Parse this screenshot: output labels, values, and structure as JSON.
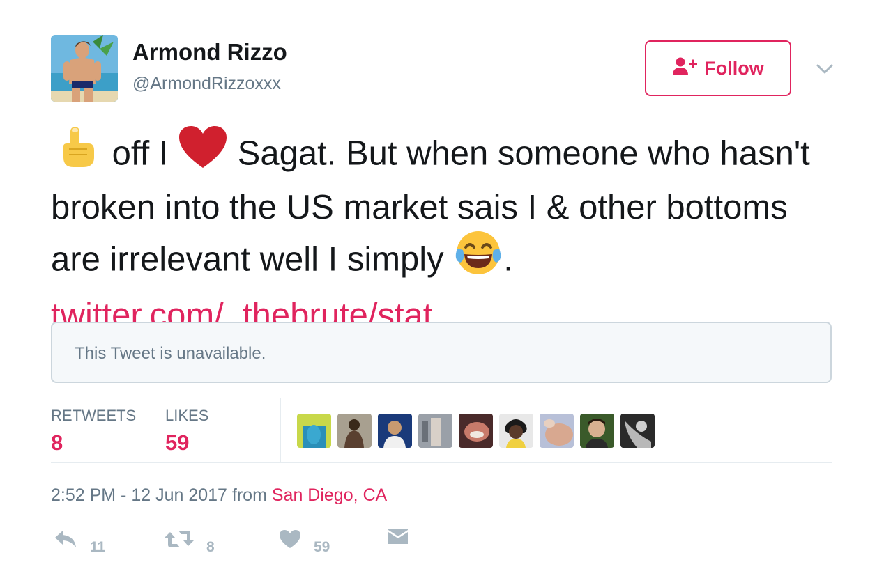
{
  "user": {
    "display_name": "Armond Rizzo",
    "screen_name": "@ArmondRizzoxxx"
  },
  "follow_button": {
    "label": "Follow"
  },
  "tweet": {
    "emoji_1": "☝",
    "segment_1": " off I ",
    "emoji_2": "heart",
    "segment_2": " Sagat. But when someone who hasn't broken into the US market sais I & other bottoms are irrelevant well I simply ",
    "emoji_3": "😂",
    "segment_3": ".",
    "link": "twitter.com/_thebrute/stat …"
  },
  "quoted_tweet": {
    "text": "This Tweet is unavailable."
  },
  "stats": {
    "retweets_label": "RETWEETS",
    "retweets_count": "8",
    "likes_label": "LIKES",
    "likes_count": "59"
  },
  "likers_count_shown": 9,
  "meta": {
    "time_date": "2:52 PM - 12 Jun 2017",
    "from": "from",
    "location": "San Diego, CA"
  },
  "actions": {
    "reply_count": "11",
    "retweet_count": "8",
    "like_count": "59"
  },
  "colors": {
    "accent": "#e0245e",
    "secondary_text": "#657786",
    "action_gray": "#aab8c2",
    "border": "#e6ecf0"
  }
}
